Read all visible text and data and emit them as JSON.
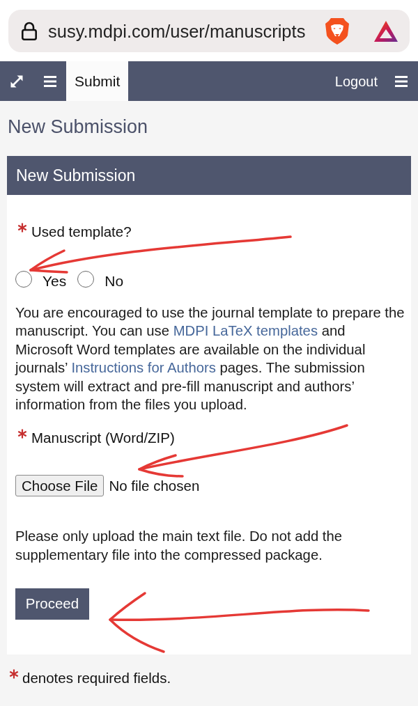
{
  "browser": {
    "url": "susy.mdpi.com/user/manuscripts"
  },
  "nav": {
    "tabs": [
      {
        "label": "Submit",
        "selected": true
      }
    ],
    "logout": "Logout"
  },
  "page_title": "New Submission",
  "card": {
    "title": "New Submission",
    "blocks": [
      {
        "kind": "radio",
        "required": true,
        "label": "Used template?",
        "options": [
          {
            "label": "Yes",
            "selected": false
          },
          {
            "label": "No",
            "selected": false
          }
        ]
      },
      {
        "kind": "note",
        "segments": [
          {
            "kind": "text",
            "text": "You are encouraged to use the journal template to prepare the manuscript. You can use "
          },
          {
            "kind": "link",
            "text": "MDPI LaTeX templates"
          },
          {
            "kind": "text",
            "text": " and Microsoft Word templates are available on the individual journals’ "
          },
          {
            "kind": "link",
            "text": "Instructions for Authors"
          },
          {
            "kind": "text",
            "text": " pages. The submission system will extract and pre-fill manuscript and authors’ information from the files you upload."
          }
        ]
      },
      {
        "kind": "file",
        "required": true,
        "label": "Manuscript (Word/ZIP)",
        "button": "Choose File",
        "status": "No file chosen"
      },
      {
        "kind": "note",
        "segments": [
          {
            "kind": "text",
            "text": "Please only upload the main text file. Do not add the supplementary file into the compressed package."
          }
        ]
      },
      {
        "kind": "submit",
        "label": "Proceed"
      }
    ]
  },
  "footnote": "denotes required fields."
}
